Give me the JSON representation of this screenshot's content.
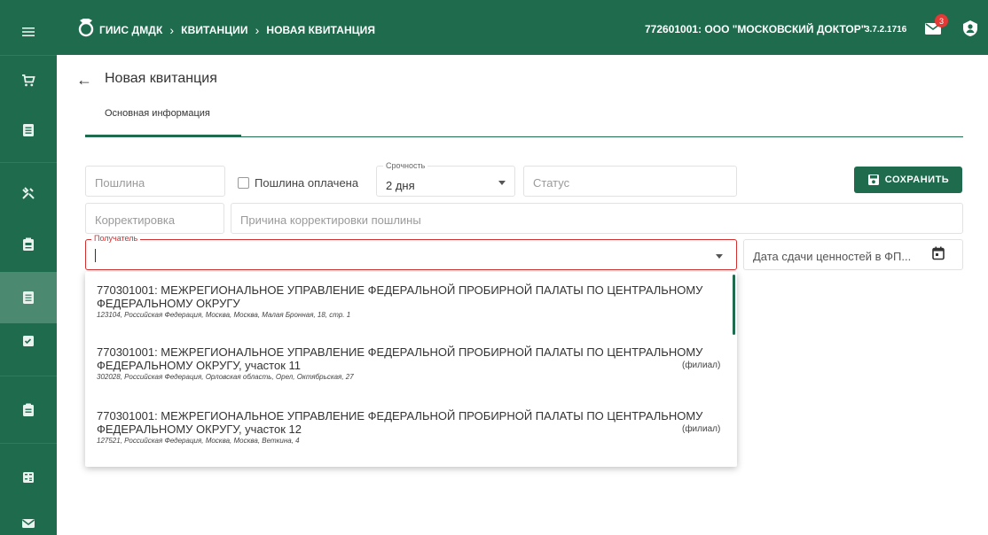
{
  "header": {
    "breadcrumb": [
      "ГИИС ДМДК",
      "КВИТАНЦИИ",
      "НОВАЯ КВИТАНЦИЯ"
    ],
    "breadcrumb_sep": "›",
    "organization": "772601001: ООО \"МОСКОВСКИЙ ДОКТОР\"",
    "version": "3.7.2.1716",
    "notifications_count": "3"
  },
  "sidebar": {
    "items": [
      "menu-icon",
      "cart-icon",
      "document-icon",
      "tools-icon",
      "id-card-icon",
      "document-list-icon",
      "check-document-icon",
      "clipboard-icon",
      "calculator-icon",
      "mail-icon"
    ],
    "active_index": 5
  },
  "page": {
    "title": "Новая квитанция",
    "tabs": [
      {
        "label": "Основная информация",
        "active": true
      }
    ]
  },
  "form": {
    "duty_placeholder": "Пошлина",
    "duty_paid_label": "Пошлина оплачена",
    "urgency_label": "Срочность",
    "urgency_value": "2 дня",
    "status_placeholder": "Статус",
    "save_label": "СОХРАНИТЬ",
    "correction_placeholder": "Корректировка",
    "correction_reason_placeholder": "Причина корректировки пошлины",
    "recipient_label": "Получатель",
    "recipient_value": "",
    "date_placeholder": "Дата сдачи ценностей в ФП..."
  },
  "recipient_options": [
    {
      "name": "770301001: МЕЖРЕГИОНАЛЬНОЕ УПРАВЛЕНИЕ ФЕДЕРАЛЬНОЙ ПРОБИРНОЙ ПАЛАТЫ ПО ЦЕНТРАЛЬНОМУ ФЕДЕРАЛЬНОМУ ОКРУГУ",
      "address": "123104, Российская Федерация, Москва, Москва, Малая Бронная, 18, стр. 1",
      "branch": ""
    },
    {
      "name": "770301001: МЕЖРЕГИОНАЛЬНОЕ УПРАВЛЕНИЕ ФЕДЕРАЛЬНОЙ ПРОБИРНОЙ ПАЛАТЫ ПО ЦЕНТРАЛЬНОМУ ФЕДЕРАЛЬНОМУ ОКРУГУ, участок 11",
      "address": "302028, Российская Федерация, Орловская область, Орел, Октябрьская, 27",
      "branch": "(филиал)"
    },
    {
      "name": "770301001: МЕЖРЕГИОНАЛЬНОЕ УПРАВЛЕНИЕ ФЕДЕРАЛЬНОЙ ПРОБИРНОЙ ПАЛАТЫ ПО ЦЕНТРАЛЬНОМУ ФЕДЕРАЛЬНОМУ ОКРУГУ, участок 12",
      "address": "127521, Российская Федерация, Москва, Москва, Веткина, 4",
      "branch": "(филиал)"
    }
  ],
  "colors": {
    "brand": "#1e6b4e",
    "sidebar_active": "#4b8a71",
    "error": "#d32f2f",
    "badge": "#e53935"
  }
}
